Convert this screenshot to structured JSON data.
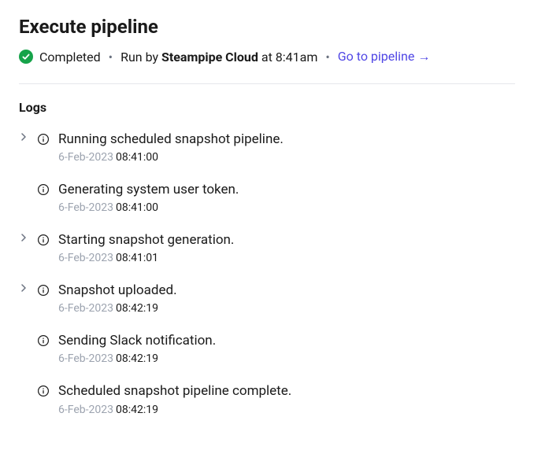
{
  "header": {
    "title": "Execute pipeline",
    "status": "Completed",
    "run_by_prefix": "Run by",
    "run_by_name": "Steampipe Cloud",
    "run_time_prefix": "at",
    "run_time": "8:41am",
    "pipeline_link": "Go to pipeline  →",
    "separator": "•"
  },
  "logs": {
    "heading": "Logs",
    "entries": [
      {
        "expandable": true,
        "message": "Running scheduled snapshot pipeline.",
        "date": "6-Feb-2023",
        "time": "08:41:00"
      },
      {
        "expandable": false,
        "message": "Generating system user token.",
        "date": "6-Feb-2023",
        "time": "08:41:00"
      },
      {
        "expandable": true,
        "message": "Starting snapshot generation.",
        "date": "6-Feb-2023",
        "time": "08:41:01"
      },
      {
        "expandable": true,
        "message": "Snapshot uploaded.",
        "date": "6-Feb-2023",
        "time": "08:42:19"
      },
      {
        "expandable": false,
        "message": "Sending Slack notification.",
        "date": "6-Feb-2023",
        "time": "08:42:19"
      },
      {
        "expandable": false,
        "message": "Scheduled snapshot pipeline complete.",
        "date": "6-Feb-2023",
        "time": "08:42:19"
      }
    ]
  },
  "colors": {
    "success": "#16a34a",
    "link": "#4f46e5"
  }
}
